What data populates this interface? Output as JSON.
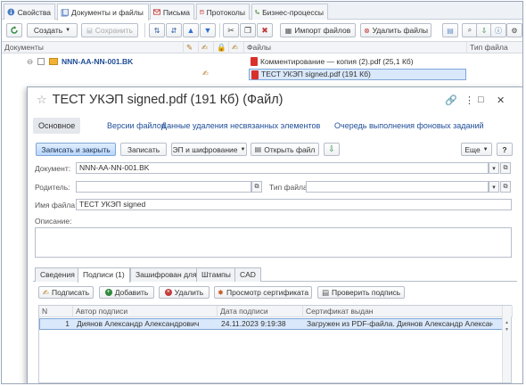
{
  "tabs": [
    {
      "label": "Свойства",
      "icon": "info-icon"
    },
    {
      "label": "Документы и файлы",
      "icon": "documents-icon"
    },
    {
      "label": "Письма",
      "icon": "letter-icon"
    },
    {
      "label": "Протоколы",
      "icon": "protocol-icon"
    },
    {
      "label": "Бизнес-процессы",
      "icon": "business-process-icon"
    }
  ],
  "toolbar": {
    "create_label": "Создать",
    "save_label": "Сохранить",
    "import_label": "Импорт файлов",
    "delete_label": "Удалить файлы"
  },
  "grid": {
    "col_documents": "Документы",
    "col_files": "Файлы",
    "col_filetype": "Тип файла",
    "doc_name": "NNN-AA-NN-001.BK",
    "file1": "Комментирование — копия (2).pdf (25,1 Кб)",
    "file2": "ТЕСТ УКЭП signed.pdf (191 Кб)"
  },
  "dialog": {
    "title": "ТЕСТ УКЭП signed.pdf (191 Кб) (Файл)",
    "nav": [
      "Основное",
      "Версии файлов",
      "Данные удаления несвязанных элементов",
      "Очередь выполнения фоновых заданий"
    ],
    "save_close": "Записать и закрыть",
    "save": "Записать",
    "ep": "ЭП и шифрование",
    "open_file": "Открыть файл",
    "more": "Еще",
    "help": "?",
    "doc_label": "Документ:",
    "doc_value": "NNN-AA-NN-001.BK",
    "parent_label": "Родитель:",
    "parent_value": "",
    "filetype_label": "Тип файла:",
    "filetype_value": "",
    "filename_label": "Имя файла:",
    "filename_value": "ТЕСТ УКЭП signed",
    "desc_label": "Описание:",
    "desc_value": "",
    "inner_tabs": [
      "Сведения",
      "Подписи (1)",
      "Зашифрован для",
      "Штампы",
      "CAD"
    ],
    "sig_toolbar": {
      "sign": "Подписать",
      "add": "Добавить",
      "delete": "Удалить",
      "view_cert": "Просмотр сертификата",
      "check": "Проверить подпись"
    },
    "sig_grid": {
      "headers": [
        "N",
        "Автор подписи",
        "Дата подписи",
        "Сертификат выдан"
      ],
      "rows": [
        {
          "n": "1",
          "author": "Диянов Александр Александрович",
          "date": "24.11.2023 9:19:38",
          "cert": "Загружен из PDF-файла. Диянов Александр Александрович"
        }
      ]
    }
  },
  "colors": {
    "accent": "#1f4e97",
    "selection": "#d9e8fb",
    "pdf": "#d9302b"
  }
}
